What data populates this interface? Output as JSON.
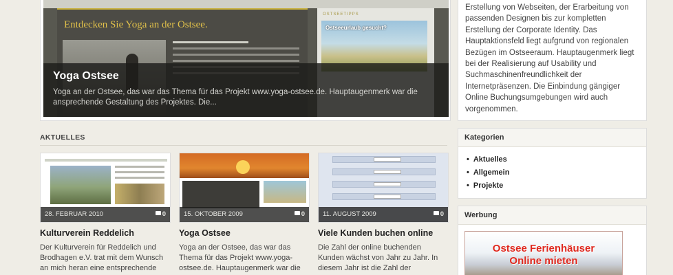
{
  "featured": {
    "title": "Yoga Ostsee",
    "excerpt": "Yoga an der Ostsee, das war das Thema für das Projekt www.yoga-ostsee.de. Hauptaugenmerk war die ansprechende Gestaltung des Projektes. Die...",
    "screenshot": {
      "heading": "Entdecken Sie Yoga an der Ostsee.",
      "side_label": "OSTSEETIPPS",
      "side_photo_text": "Ostseeurlaub gesucht?"
    }
  },
  "section": {
    "title": "AKTUELLES"
  },
  "posts": [
    {
      "title": "Kulturverein Reddelich",
      "date": "28. FEBRUAR 2010",
      "comments": "0",
      "excerpt": "Der Kulturverein für Reddelich und Brodhagen e.V. trat mit dem Wunsch an mich heran eine entsprechende Webseite zu realisieren, über diese"
    },
    {
      "title": "Yoga Ostsee",
      "date": "15. OKTOBER 2009",
      "comments": "0",
      "excerpt": "Yoga an der Ostsee, das war das Thema für das Projekt www.yoga-ostsee.de. Hauptaugenmerk war die ansprechende Gestaltung des"
    },
    {
      "title": "Viele Kunden buchen online",
      "date": "11. AUGUST 2009",
      "comments": "0",
      "excerpt": "Die Zahl der online buchenden Kunden wächst von Jahr zu Jahr. In diesem Jahr ist die Zahl der Direktonlinebuchungen stark"
    }
  ],
  "sidebar": {
    "about_text": "Erstellung von Webseiten, der Erarbeitung von passenden Designen bis zur kompletten Erstellung der Corporate Identity. Das Hauptaktionsfeld liegt aufgrund von regionalen Bezügen im Ostseeraum. Hauptaugenmerk liegt bei der Realisierung auf Usability und Suchmaschinenfreundlichkeit der Internetpräsenzen. Die Einbindung gängiger Online Buchungsumgebungen wird auch vorgenommen.",
    "categories_title": "Kategorien",
    "categories": [
      "Aktuelles",
      "Allgemein",
      "Projekte"
    ],
    "ad_title": "Werbung",
    "ad_text_line1": "Ostsee Ferienhäuser",
    "ad_text_line2": "Online mieten"
  },
  "colors": {
    "accent_red": "#e0281e",
    "heading_gold": "#e0c04a",
    "background": "#efede6"
  }
}
